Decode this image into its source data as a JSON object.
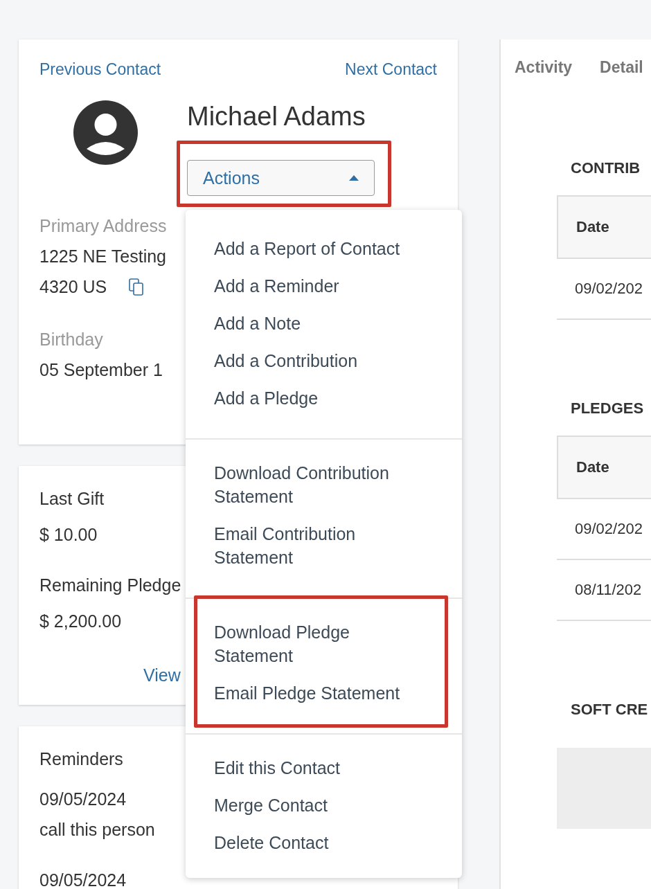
{
  "navigation": {
    "previous": "Previous Contact",
    "next": "Next Contact"
  },
  "contact": {
    "name": "Michael Adams",
    "actions_button": {
      "label": "Actions",
      "expanded": true,
      "highlighted": true
    },
    "fields": [
      {
        "kind": "address",
        "label": "Primary Address",
        "lines": [
          "1225 NE Testing",
          "4320 US"
        ]
      },
      {
        "kind": "text",
        "label": "Birthday",
        "lines": [
          "05 September 1"
        ]
      }
    ]
  },
  "giving_summary": {
    "items": [
      {
        "label": "Last Gift",
        "value": "$ 10.00"
      },
      {
        "label": "Remaining Pledge",
        "value": "$ 2,200.00"
      }
    ],
    "link": "View"
  },
  "reminders": {
    "title": "Reminders",
    "items": [
      {
        "date": "09/05/2024",
        "text": "call this person"
      },
      {
        "date": "09/05/2024"
      }
    ]
  },
  "actions_menu": {
    "groups": [
      {
        "items": [
          "Add a Report of Contact",
          "Add a Reminder",
          "Add a Note",
          "Add a Contribution",
          "Add a Pledge"
        ]
      },
      {
        "items": [
          "Download Contribution Statement",
          "Email Contribution Statement"
        ]
      },
      {
        "highlighted": true,
        "items": [
          "Download Pledge Statement",
          "Email Pledge Statement"
        ]
      },
      {
        "items": [
          "Edit this Contact",
          "Merge Contact",
          "Delete Contact"
        ]
      }
    ]
  },
  "tabs": [
    {
      "label": "Activity"
    },
    {
      "label": "Detail"
    }
  ],
  "sections": [
    {
      "kind": "table",
      "title": "CONTRIB",
      "header": "Date",
      "rows": [
        "09/02/202"
      ]
    },
    {
      "kind": "table",
      "title": "PLEDGES",
      "header": "Date",
      "rows": [
        "09/02/202",
        "08/11/202"
      ]
    },
    {
      "kind": "empty",
      "title": "SOFT CRE"
    }
  ]
}
